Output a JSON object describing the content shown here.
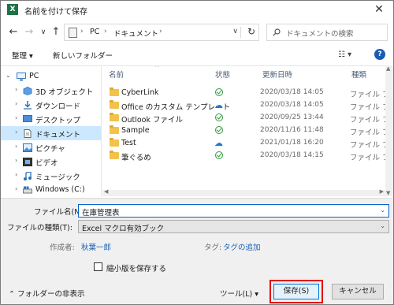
{
  "window": {
    "title": "名前を付けて保存",
    "app_icon_letter": "X",
    "close_symbol": "✕"
  },
  "nav": {
    "back": "←",
    "forward": "→",
    "recent": "∨",
    "up": "↑",
    "path": [
      "PC",
      "ドキュメント"
    ],
    "chevron": "›",
    "refresh": "↻",
    "search_placeholder": "ドキュメントの検索"
  },
  "commands": {
    "organize": "整理 ▾",
    "new_folder": "新しいフォルダー",
    "view": "☷ ▾",
    "help": "?"
  },
  "sidebar": {
    "items": [
      {
        "label": "PC",
        "icon": "pc-icon"
      },
      {
        "label": "3D オブジェクト",
        "icon": "3d-objects-icon"
      },
      {
        "label": "ダウンロード",
        "icon": "download-icon"
      },
      {
        "label": "デスクトップ",
        "icon": "desktop-icon"
      },
      {
        "label": "ドキュメント",
        "icon": "documents-icon"
      },
      {
        "label": "ピクチャ",
        "icon": "pictures-icon"
      },
      {
        "label": "ビデオ",
        "icon": "videos-icon"
      },
      {
        "label": "ミュージック",
        "icon": "music-icon"
      },
      {
        "label": "Windows (C:)",
        "icon": "drive-icon"
      }
    ]
  },
  "columns": {
    "name": "名前",
    "status": "状態",
    "modified": "更新日時",
    "type": "種類"
  },
  "files": [
    {
      "name": "CyberLink",
      "status": "ok",
      "date": "2020/03/18 14:05",
      "type": "ファイル フォル"
    },
    {
      "name": "Office のカスタム テンプレート",
      "status": "cloud",
      "date": "2020/03/18 14:05",
      "type": "ファイル フォル"
    },
    {
      "name": "Outlook ファイル",
      "status": "ok",
      "date": "2020/09/25 13:44",
      "type": "ファイル フォル"
    },
    {
      "name": "Sample",
      "status": "ok",
      "date": "2020/11/16 11:48",
      "type": "ファイル フォル"
    },
    {
      "name": "Test",
      "status": "cloud",
      "date": "2021/01/18 16:20",
      "type": "ファイル フォル"
    },
    {
      "name": "筆ぐるめ",
      "status": "ok",
      "date": "2020/03/18 14:15",
      "type": "ファイル フォル"
    }
  ],
  "form": {
    "filename_label": "ファイル名(N):",
    "filename_value": "在庫管理表",
    "filetype_label": "ファイルの種類(T):",
    "filetype_value": "Excel マクロ有効ブック",
    "author_label": "作成者:",
    "author_value": "秋葉一郎",
    "tags_label": "タグ:",
    "tags_value": "タグの追加",
    "thumbnail_label": "縮小版を保存する",
    "hide_folders": "フォルダーの非表示",
    "tools": "ツール(L) ▾",
    "save": "保存(S)",
    "cancel": "キャンセル"
  }
}
